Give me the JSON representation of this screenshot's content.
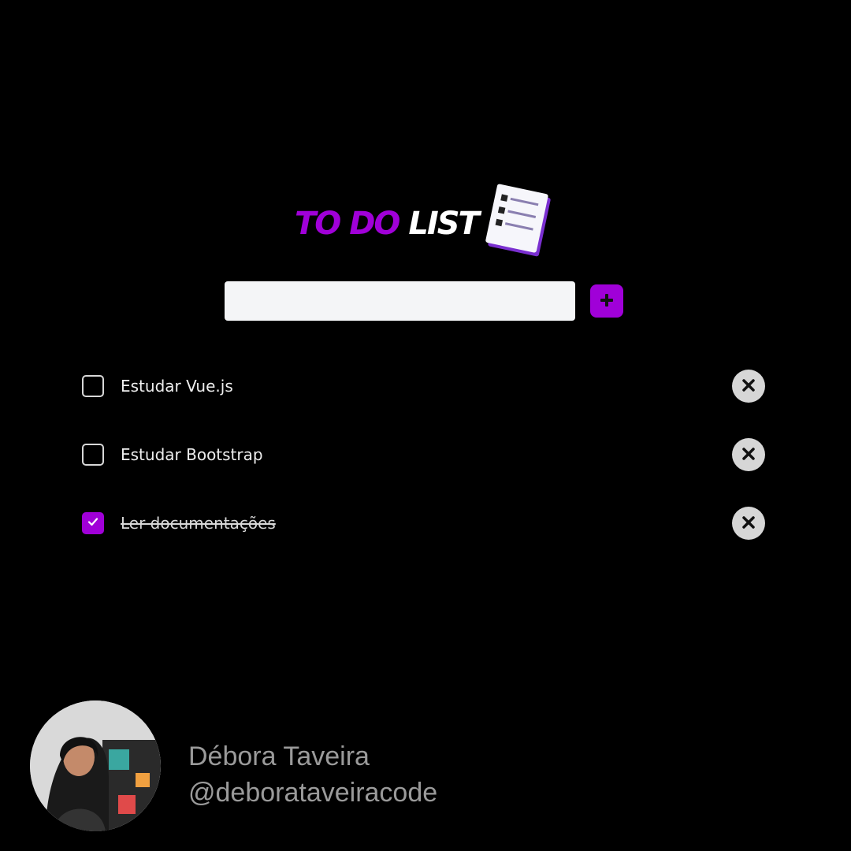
{
  "header": {
    "title_accent": "TO DO",
    "title_plain": "LIST",
    "icon": "checklist-icon"
  },
  "input": {
    "value": "",
    "placeholder": "",
    "add_icon": "plus-icon"
  },
  "tasks": [
    {
      "label": "Estudar Vue.js",
      "done": false
    },
    {
      "label": "Estudar Bootstrap",
      "done": false
    },
    {
      "label": "Ler documentações",
      "done": true
    }
  ],
  "task_icons": {
    "checkbox": "checkbox-icon",
    "check": "check-icon",
    "delete": "close-icon"
  },
  "author": {
    "name": "Débora Taveira",
    "handle": "@deborataveiracode"
  },
  "colors": {
    "background": "#000000",
    "accent": "#a000d8",
    "input_bg": "#f4f5f7",
    "delete_bg": "#d6d6d6",
    "text": "#eeeeee",
    "footer_text": "#9a9a9a"
  }
}
